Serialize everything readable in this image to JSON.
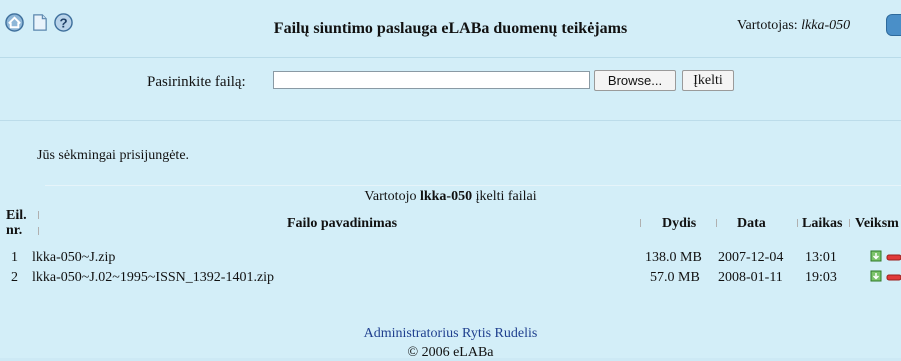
{
  "header": {
    "title": "Failų siuntimo paslauga eLABa duomenų teikėjams",
    "user_label": "Vartotojas:",
    "user_name": "lkka-050"
  },
  "upload": {
    "label": "Pasirinkite failą:",
    "file_value": "",
    "browse_label": "Browse...",
    "submit_label": "Įkelti"
  },
  "message": "Jūs sėkmingai prisijungėte.",
  "files": {
    "caption_prefix": "Vartotojo",
    "caption_user": "lkka-050",
    "caption_suffix": "įkelti failai",
    "columns": {
      "nr_line1": "Eil.",
      "nr_line2": "nr.",
      "name": "Failo pavadinimas",
      "size": "Dydis",
      "date": "Data",
      "time": "Laikas",
      "actions": "Veiksm"
    },
    "rows": [
      {
        "nr": "1",
        "name": "lkka-050~J.zip",
        "size": "138.0 MB",
        "date": "2007-12-04",
        "time": "13:01"
      },
      {
        "nr": "2",
        "name": "lkka-050~J.02~1995~ISSN_1392-1401.zip",
        "size": "57.0 MB",
        "date": "2008-01-11",
        "time": "19:03"
      }
    ]
  },
  "footer": {
    "admin": "Administratorius Rytis Rudelis",
    "copyright": "© 2006 eLABa"
  }
}
